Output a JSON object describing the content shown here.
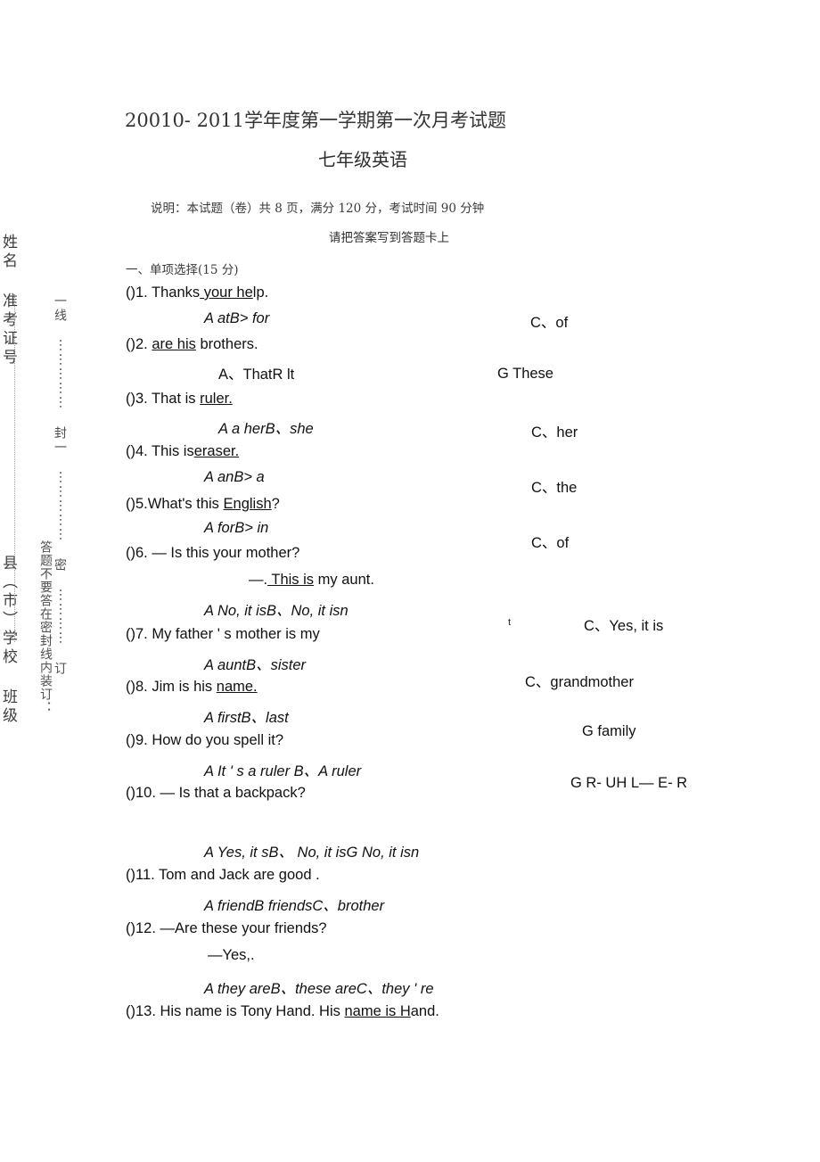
{
  "sidebar": {
    "col_name_exam": "姓名  准考证号",
    "col_school_class": "县（市）学校  班级",
    "col_seal_line": "一线 ⋯⋯⋯⋯⋯ 封一 ⋯⋯⋯⋯⋯ 密 ⋯⋯⋯⋯ 订",
    "col_warning": "答题不要答在密封线内装订："
  },
  "header": {
    "title": "20010- 2011学年度第一学期第一次月考试题",
    "subtitle": "七年级英语",
    "note_line1": "说明：本试题（卷）共 8 页，满分 120 分，考试时间 90 分钟",
    "note_line2": "请把答案写到答题卡上"
  },
  "section": {
    "heading": "一、单项选择(15 分)"
  },
  "questions": [
    {
      "id": "q1",
      "stem": "()1. Thanks your help.",
      "stem_pre": "()1. Thanks",
      "stem_blank": " your he",
      "stem_post": "lp.",
      "options_left": "A atB> for",
      "options_right": "C、of"
    },
    {
      "id": "q2",
      "stem": "()2. are his brothers.",
      "stem_pre": "()2. ",
      "stem_blank": "are his",
      "stem_post": " brothers.",
      "options_left": "A、ThatR lt",
      "options_right": "G These"
    },
    {
      "id": "q3",
      "stem": "()3. That is ruler.",
      "stem_pre": "()3. That is ",
      "stem_blank": "ruler.",
      "stem_post": "",
      "options_left": "A a herB、she",
      "options_right": "C、her"
    },
    {
      "id": "q4",
      "stem": "()4. This iseraser.",
      "stem_pre": "()4. This is",
      "stem_blank": "eraser.",
      "stem_post": "",
      "options_left": "A anB> a",
      "options_right": "C、the"
    },
    {
      "id": "q5",
      "stem": "()5.What's this English?",
      "stem_pre": "()5.What's this ",
      "stem_blank": "English",
      "stem_post": "?",
      "options_left": "A forB> in",
      "options_right": "C、of"
    },
    {
      "id": "q6",
      "stem": "()6. — Is this your mother?",
      "stem_pre": "()6. — Is this your mother?",
      "stem_blank": "",
      "stem_post": "",
      "reply_pre": "—.",
      "reply_blank": "  This is",
      "reply_post": " my aunt.",
      "options_left": "A No, it isB、No, it isn",
      "options_right": "C、Yes, it is",
      "stray_mark": "t"
    },
    {
      "id": "q7",
      "stem": "()7. My father ' s mother is my",
      "stem_pre": "()7. My father ' s mother is my",
      "stem_blank": "",
      "stem_post": "",
      "options_left": "A auntB、sister",
      "options_right": "C、grandmother"
    },
    {
      "id": "q8",
      "stem": "()8. Jim is his name.",
      "stem_pre": "()8. Jim is his ",
      "stem_blank": "name.",
      "stem_post": "",
      "options_left": "A firstB、last",
      "options_right": "G family"
    },
    {
      "id": "q9",
      "stem": "()9. How do you spell it?",
      "stem_pre": "()9. How do you spell it?",
      "stem_blank": "",
      "stem_post": "",
      "options_left": "A It ' s a ruler B、A ruler",
      "options_right": "G R- UH L— E- R"
    },
    {
      "id": "q10",
      "stem": "()10. — Is that a backpack?",
      "stem_pre": "()10. — Is that a backpack?",
      "stem_blank": "",
      "stem_post": "",
      "options_left": "A Yes, it sB、  No, it isG No, it isn",
      "options_right": ""
    },
    {
      "id": "q11",
      "stem": "()11. Tom and Jack are good .",
      "stem_pre": "()11. Tom and Jack are good .",
      "stem_blank": "",
      "stem_post": "",
      "options_left": "A friendB friendsC、brother",
      "options_right": ""
    },
    {
      "id": "q12",
      "stem": "()12. —Are these your friends?",
      "stem_pre": "()12. —Are these your friends?",
      "stem_blank": "",
      "stem_post": "",
      "reply_pre": "—Yes,.",
      "reply_blank": "",
      "reply_post": "",
      "options_left": "A they areB、these areC、they ' re",
      "options_right": ""
    },
    {
      "id": "q13",
      "stem": "()13. His name is Tony Hand. His name is Hand.",
      "stem_pre": "()13. His name is Tony Hand. His ",
      "stem_blank": "name is H",
      "stem_post": "and.",
      "options_left": "",
      "options_right": ""
    }
  ]
}
